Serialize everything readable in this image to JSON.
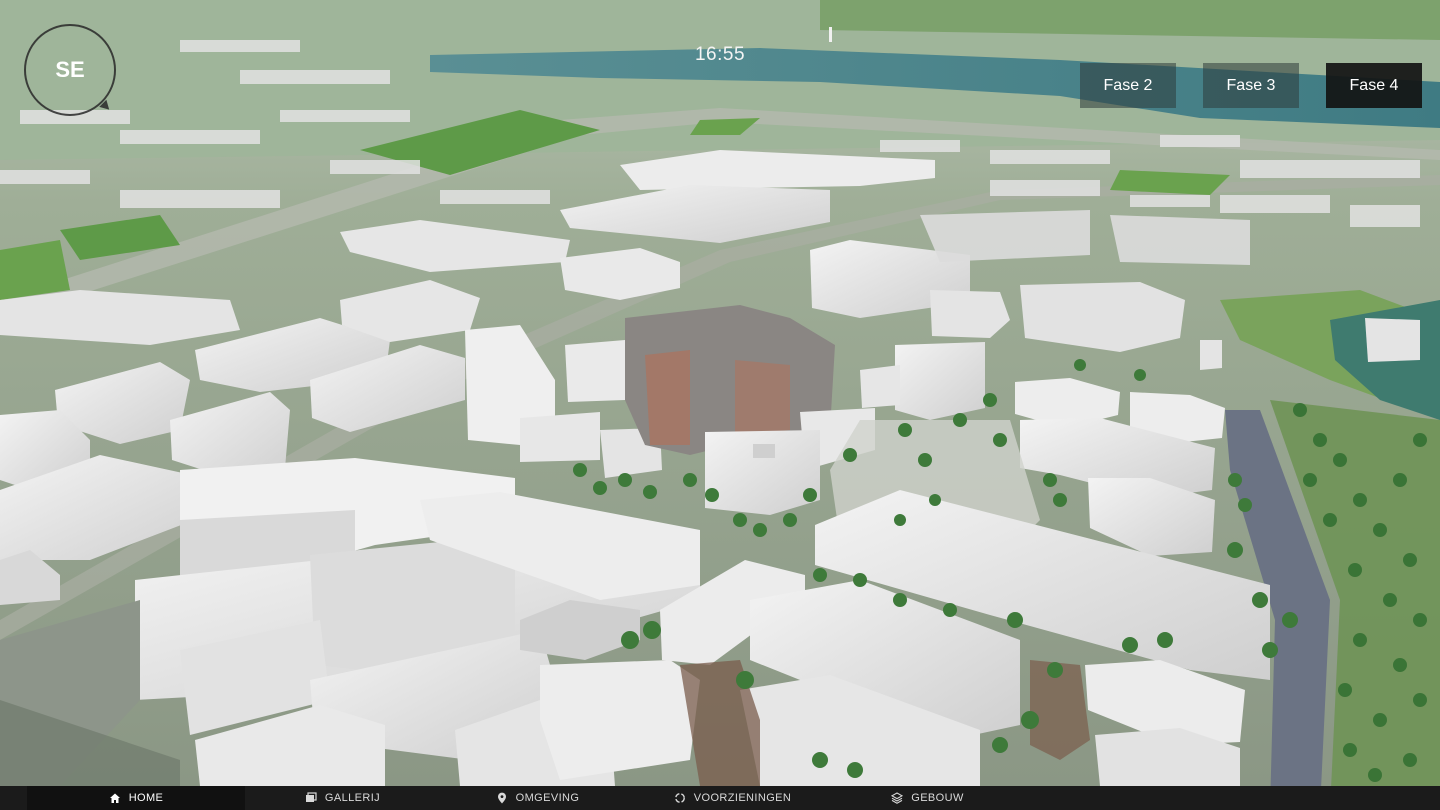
{
  "compass": {
    "label": "SE"
  },
  "clock": {
    "time": "16:55"
  },
  "phases": [
    {
      "label": "Fase 2",
      "active": false
    },
    {
      "label": "Fase 3",
      "active": false
    },
    {
      "label": "Fase 4",
      "active": true
    }
  ],
  "nav": [
    {
      "label": "HOME",
      "icon": "home-icon",
      "active": true
    },
    {
      "label": "GALLERIJ",
      "icon": "gallery-icon",
      "active": false
    },
    {
      "label": "OMGEVING",
      "icon": "location-pin-icon",
      "active": false
    },
    {
      "label": "VOORZIENINGEN",
      "icon": "circle-arrows-icon",
      "active": false
    },
    {
      "label": "GEBOUW",
      "icon": "layers-icon",
      "active": false
    }
  ],
  "colors": {
    "ground": "#8a9c84",
    "grass": "#5f9a4a",
    "water": "#4f8a8c",
    "building": "#e9e9e9",
    "tree": "#3e7a3a",
    "phase_button": "#2d3a3a",
    "phase_active": "#121414",
    "navbar": "#1b1b1b"
  }
}
